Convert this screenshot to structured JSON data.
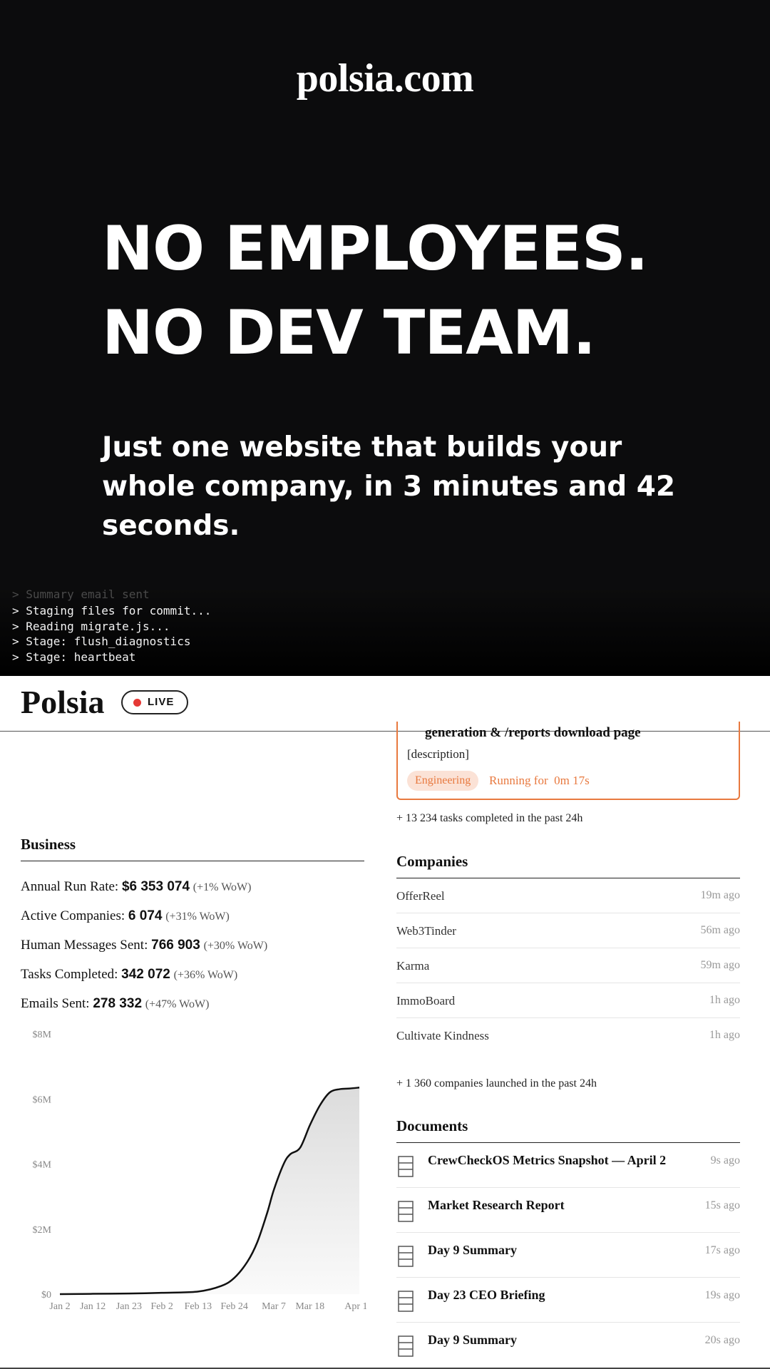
{
  "hero": {
    "brand": "polsia.com",
    "headline": [
      "NO EMPLOYEES.",
      "NO DEV TEAM."
    ],
    "subheadline": "Just one website that builds your whole company, in 3 minutes and 42 seconds.",
    "terminal_lines": [
      "> Summary email sent",
      "> Staging files for commit...",
      "> Reading migrate.js...",
      "> Stage: flush_diagnostics",
      "> Stage: heartbeat"
    ]
  },
  "header": {
    "logo": "Polsia",
    "live_label": "LIVE",
    "live_color": "#e53935"
  },
  "task": {
    "title": "generation & /reports download page",
    "description": "[description]",
    "tag": "Engineering",
    "running": "Running for  0m 17s",
    "accent": "#e8793f",
    "tasks_note": "+ 13 234 tasks completed in the past 24h"
  },
  "business": {
    "title": "Business",
    "metrics": [
      {
        "label": "Annual Run Rate:",
        "value": "$6 353 074",
        "change": "(+1% WoW)"
      },
      {
        "label": "Active Companies:",
        "value": "6 074",
        "change": "(+31% WoW)"
      },
      {
        "label": "Human Messages Sent:",
        "value": "766 903",
        "change": "(+30% WoW)"
      },
      {
        "label": "Tasks Completed:",
        "value": "342 072",
        "change": "(+36% WoW)"
      },
      {
        "label": "Emails Sent:",
        "value": "278 332",
        "change": "(+47% WoW)"
      }
    ]
  },
  "chart_data": {
    "type": "area",
    "title": "",
    "xlabel": "",
    "ylabel": "",
    "x_tick_labels": [
      "Jan 2",
      "Jan 12",
      "Jan 23",
      "Feb 2",
      "Feb 13",
      "Feb 24",
      "Mar 7",
      "Mar 18",
      "Apr 1"
    ],
    "y_tick_labels": [
      "$0",
      "$2M",
      "$4M",
      "$6M",
      "$8M"
    ],
    "ylim": [
      0,
      8000000
    ],
    "xlim": [
      "Jan 2",
      "Apr 2"
    ],
    "x": [
      "Jan 2",
      "Jan 12",
      "Jan 23",
      "Feb 2",
      "Feb 13",
      "Feb 20",
      "Feb 24",
      "Feb 28",
      "Mar 2",
      "Mar 5",
      "Mar 7",
      "Mar 10",
      "Mar 12",
      "Mar 15",
      "Mar 18",
      "Mar 21",
      "Mar 24",
      "Mar 27",
      "Mar 30",
      "Apr 2"
    ],
    "series": [
      {
        "values": [
          0,
          10000,
          20000,
          40000,
          80000,
          250000,
          500000,
          1000000,
          1600000,
          2500000,
          3200000,
          4000000,
          4300000,
          4500000,
          5200000,
          5800000,
          6200000,
          6300000,
          6320000,
          6350000
        ]
      }
    ],
    "grid": false,
    "legend": "none",
    "line_color": "#111111"
  },
  "companies": {
    "title": "Companies",
    "items": [
      {
        "name": "OfferReel",
        "time": "19m ago"
      },
      {
        "name": "Web3Tinder",
        "time": "56m ago"
      },
      {
        "name": "Karma",
        "time": "59m ago"
      },
      {
        "name": "ImmoBoard",
        "time": "1h ago"
      },
      {
        "name": "Cultivate Kindness",
        "time": "1h ago"
      }
    ],
    "note": "+ 1 360 companies launched in the past 24h"
  },
  "documents": {
    "title": "Documents",
    "icon": "document-icon",
    "items": [
      {
        "title": "CrewCheckOS Metrics Snapshot — April 2",
        "time": "9s ago"
      },
      {
        "title": "Market Research Report",
        "time": "15s ago"
      },
      {
        "title": "Day 9 Summary",
        "time": "17s ago"
      },
      {
        "title": "Day 23 CEO Briefing",
        "time": "19s ago"
      },
      {
        "title": "Day 9 Summary",
        "time": "20s ago"
      }
    ]
  }
}
